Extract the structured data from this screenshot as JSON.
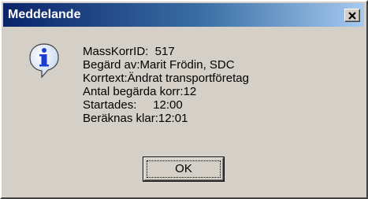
{
  "window": {
    "title": "Meddelande",
    "close_icon": "close-icon"
  },
  "dialog": {
    "icon": "information-icon",
    "lines": [
      "MassKorrID:  517",
      "Begärd av:Marit Frödin, SDC",
      "Korrtext:Ändrat transportföretag",
      "Antal begärda korr:12",
      "Startades:     12:00",
      "Beräknas klar:12:01"
    ],
    "ok_label": "OK"
  },
  "colors": {
    "title_bar_start": "#0a246a",
    "title_bar_end": "#a6caf0",
    "face": "#d4d0c8"
  }
}
